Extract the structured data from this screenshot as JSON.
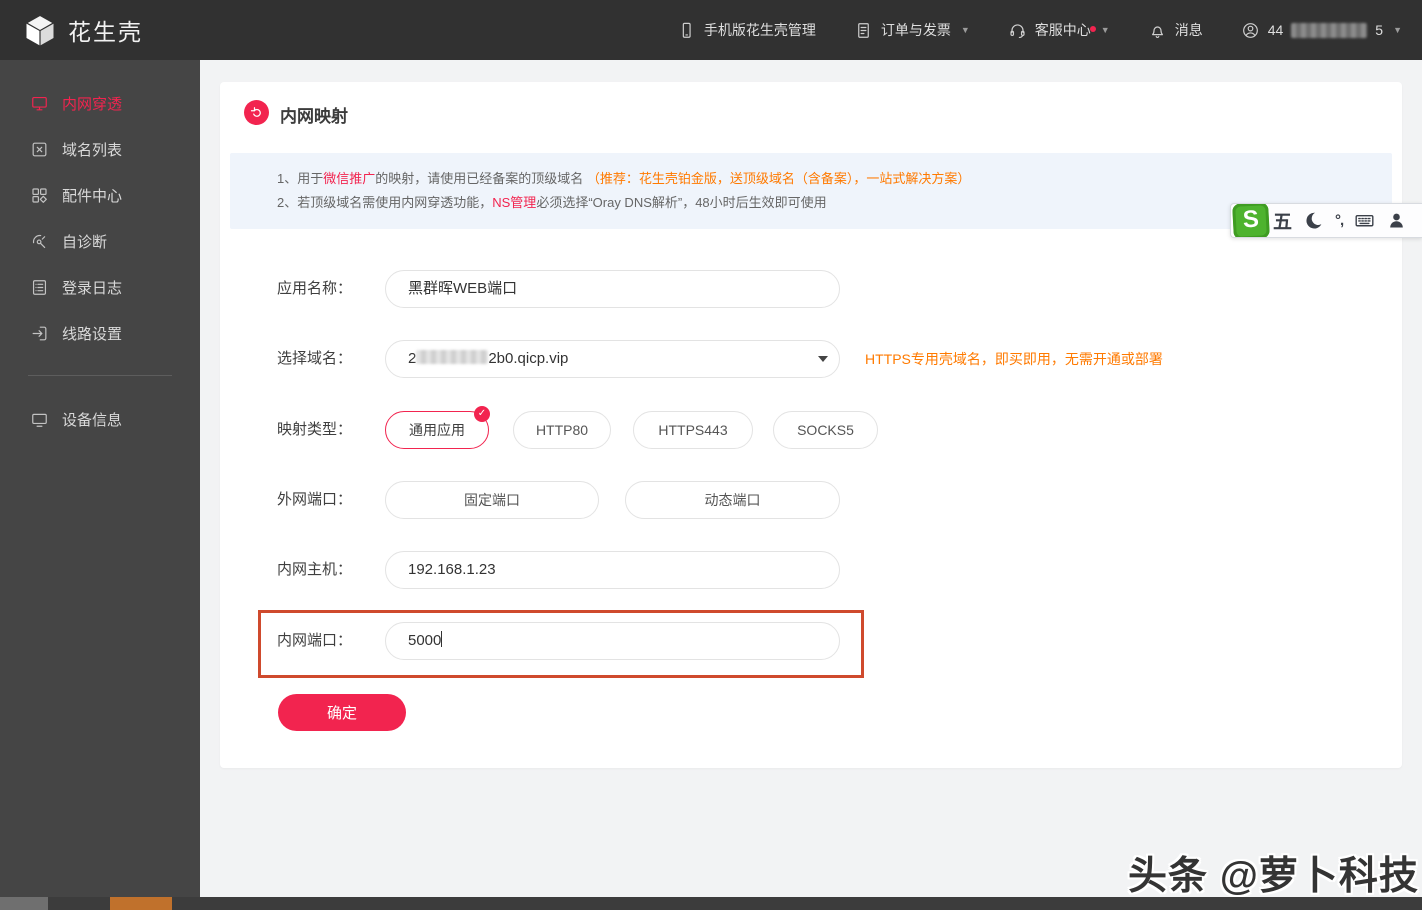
{
  "colors": {
    "accent": "#f2244f",
    "orange": "#ff7a00",
    "notice_bg": "#eff4fb",
    "sidebar_bg": "#454545",
    "topbar_bg": "#313131",
    "sogou_green": "#4eb32e",
    "annotation_red": "#cf4a2d"
  },
  "navbar": {
    "brand": "花生壳",
    "mobile_admin": "手机版花生壳管理",
    "orders": "订单与发票",
    "support": "客服中心",
    "messages": "消息",
    "account_prefix": "44",
    "account_suffix": "5"
  },
  "sidebar": {
    "items": [
      {
        "label": "内网穿透",
        "active": true
      },
      {
        "label": "域名列表"
      },
      {
        "label": "配件中心"
      },
      {
        "label": "自诊断"
      },
      {
        "label": "登录日志"
      },
      {
        "label": "线路设置"
      },
      {
        "label": "设备信息"
      }
    ]
  },
  "page": {
    "title": "内网映射"
  },
  "notice": {
    "line1_no": "1、",
    "line1_a": "用于",
    "line1_red": "微信推广",
    "line1_b": "的映射，请使用已经备案的顶级域名 ",
    "line1_orange": "（推荐：花生壳铂金版，送顶级域名（含备案），一站式解决方案）",
    "line2_no": "2、",
    "line2_a": "若顶级域名需使用内网穿透功能，",
    "line2_red": "NS管理",
    "line2_b": "必须选择“Oray DNS解析”，48小时后生效即可使用"
  },
  "form": {
    "app_name": {
      "label": "应用名称：",
      "value": "黑群晖WEB端口"
    },
    "domain": {
      "label": "选择域名：",
      "value_prefix": "2",
      "value_suffix": "2b0.qicp.vip",
      "hint": "HTTPS专用壳域名，即买即用，无需开通或部署"
    },
    "map_type": {
      "label": "映射类型：",
      "options": [
        "通用应用",
        "HTTP80",
        "HTTPS443",
        "SOCKS5"
      ],
      "selected": "通用应用"
    },
    "ext_port": {
      "label": "外网端口：",
      "options": [
        "固定端口",
        "动态端口"
      ]
    },
    "host": {
      "label": "内网主机：",
      "value": "192.168.1.23"
    },
    "port": {
      "label": "内网端口：",
      "value": "5000"
    },
    "submit_label": "确定"
  },
  "ime": {
    "logo_letter": "S",
    "mode_label": "五",
    "punct_label": "°,"
  },
  "watermark": {
    "text": "头条 @萝卜科技"
  }
}
